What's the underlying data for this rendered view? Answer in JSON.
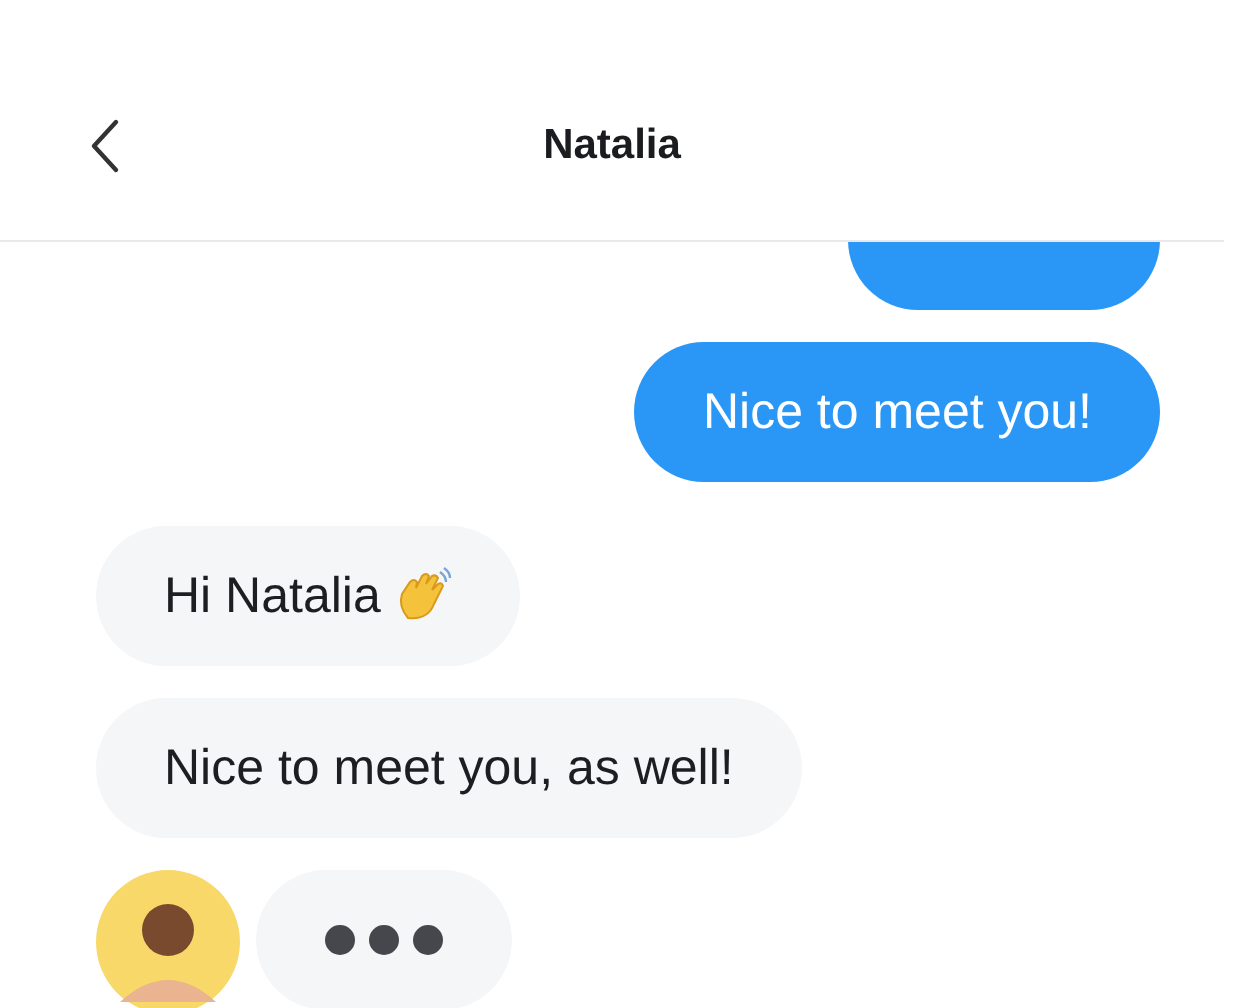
{
  "header": {
    "title": "Natalia"
  },
  "messages": [
    {
      "kind": "outgoing",
      "avatar": false
    },
    {
      "kind": "outgoing",
      "text": "Nice to meet you!",
      "avatar": false
    },
    {
      "kind": "incoming",
      "text": "Hi Natalia",
      "wave": true,
      "avatar": false
    },
    {
      "kind": "incoming",
      "text": "Nice to meet you, as well!",
      "wave": false,
      "avatar": false
    },
    {
      "kind": "typing",
      "avatar": true
    }
  ]
}
